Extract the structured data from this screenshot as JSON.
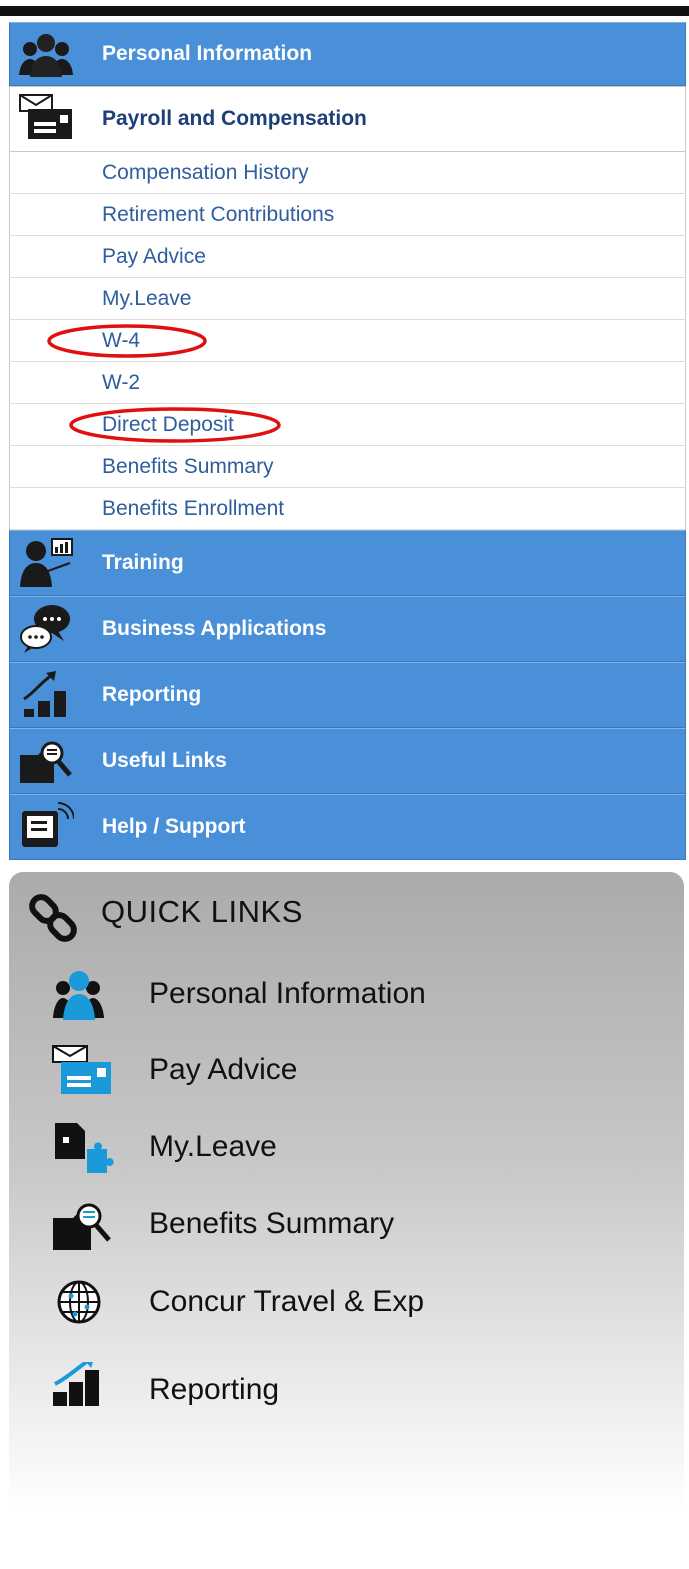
{
  "menu": {
    "sections_top": [
      {
        "label": "Personal Information",
        "icon": "users-icon"
      },
      {
        "label": "Payroll and Compensation",
        "icon": "envelope-payroll-icon"
      }
    ],
    "payroll_items": [
      {
        "label": "Compensation History"
      },
      {
        "label": "Retirement Contributions"
      },
      {
        "label": "Pay Advice"
      },
      {
        "label": "My.Leave"
      },
      {
        "label": "W-4"
      },
      {
        "label": "W-2"
      },
      {
        "label": "Direct Deposit"
      },
      {
        "label": "Benefits Summary"
      },
      {
        "label": "Benefits Enrollment"
      }
    ],
    "sections_bottom": [
      {
        "label": "Training",
        "icon": "presenter-icon"
      },
      {
        "label": "Business Applications",
        "icon": "chat-bubbles-icon"
      },
      {
        "label": "Reporting",
        "icon": "growth-chart-icon"
      },
      {
        "label": "Useful Links",
        "icon": "folder-search-icon"
      },
      {
        "label": "Help / Support",
        "icon": "support-screen-icon"
      }
    ]
  },
  "quick_links": {
    "title": "QUICK LINKS",
    "items": [
      {
        "label": "Personal Information",
        "icon": "users-icon"
      },
      {
        "label": "Pay Advice",
        "icon": "envelope-payroll-icon"
      },
      {
        "label": "My.Leave",
        "icon": "puzzle-doc-icon"
      },
      {
        "label": "Benefits Summary",
        "icon": "folder-search-icon"
      },
      {
        "label": "Concur Travel & Exp",
        "icon": "globe-icon"
      },
      {
        "label": "Reporting",
        "icon": "growth-chart-icon"
      }
    ]
  },
  "colors": {
    "menu_blue": "#4a90d9",
    "link_blue": "#2f5d9e",
    "highlight_red": "#e01010",
    "quick_icon_blue": "#1a9ad9"
  }
}
